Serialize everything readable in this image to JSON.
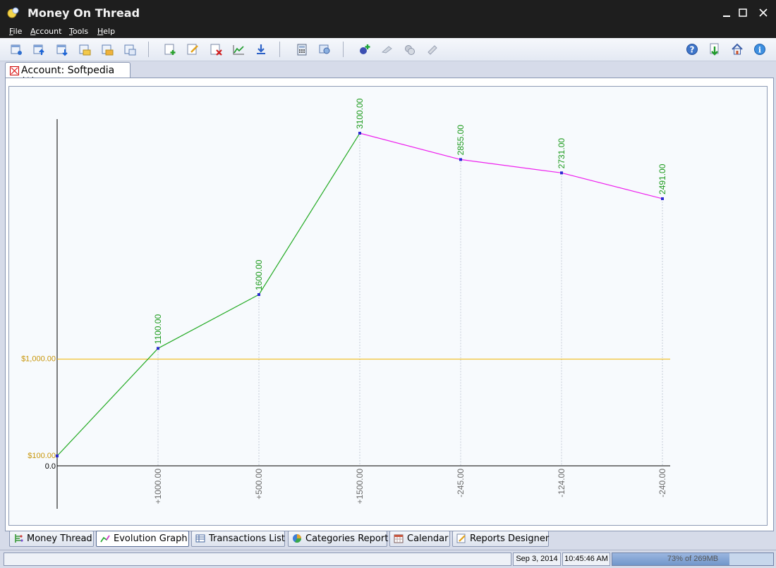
{
  "window": {
    "title": "Money On Thread"
  },
  "menu": [
    "File",
    "Account",
    "Tools",
    "Help"
  ],
  "toolbar_icons": [
    "new-account-icon",
    "import-icon",
    "export-icon",
    "open-folder-icon",
    "save-folder-icon",
    "properties-icon",
    "add-transaction-icon",
    "edit-transaction-icon",
    "delete-transaction-icon",
    "graph-icon",
    "download-icon",
    "calculator-icon",
    "settings-icon",
    "add-user-icon",
    "sign-icon",
    "coins-icon",
    "clear-icon",
    "help-icon",
    "update-icon",
    "home-icon",
    "info-icon"
  ],
  "document_tab": {
    "label": "Account: Softpedia ($)"
  },
  "bottom_tabs": [
    {
      "label": "Money Thread",
      "icon": "money-thread-icon",
      "active": false
    },
    {
      "label": "Evolution Graph",
      "icon": "evolution-graph-icon",
      "active": true
    },
    {
      "label": "Transactions List",
      "icon": "transactions-list-icon",
      "active": false
    },
    {
      "label": "Categories Report",
      "icon": "categories-report-icon",
      "active": false
    },
    {
      "label": "Calendar",
      "icon": "calendar-icon",
      "active": false
    },
    {
      "label": "Reports Designer",
      "icon": "reports-designer-icon",
      "active": false
    }
  ],
  "status": {
    "date": "Sep 3, 2014",
    "time": "10:45:46 AM",
    "memory": "73% of 269MB",
    "memory_percent": 73
  },
  "chart_data": {
    "type": "line",
    "x": [
      "",
      "+1000.00",
      "+500.00",
      "+1500.00",
      "-245.00",
      "-124.00",
      "-240.00"
    ],
    "values": [
      100,
      1100,
      1600,
      3100,
      2855,
      2731,
      2491
    ],
    "value_labels": [
      "",
      "1100.00",
      "1600.00",
      "3100.00",
      "2855.00",
      "2731.00",
      "2491.00"
    ],
    "y_ticks": [
      "$100.00",
      "0.0"
    ],
    "reference_line": {
      "value": 1000,
      "label": "$1,000.00"
    },
    "colors": {
      "rising": "#22aa22",
      "falling": "#ee22ee",
      "reference": "#f0b400",
      "value_label": "#1c9a1c",
      "tick": "#6a6a6a"
    }
  }
}
